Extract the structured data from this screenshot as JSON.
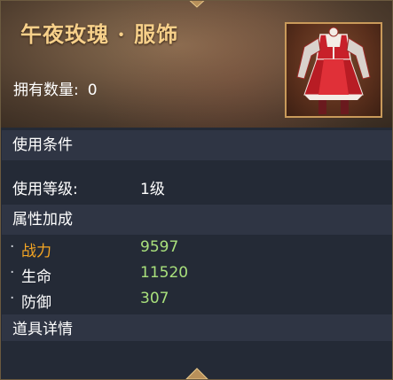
{
  "header": {
    "title": "午夜玫瑰 · 服饰",
    "owned_label": "拥有数量:",
    "owned_value": "0",
    "thumbnail_icon": "red-white-dress-costume-icon"
  },
  "usage": {
    "section_title": "使用条件",
    "level_label": "使用等级:",
    "level_value": "1级"
  },
  "attributes": {
    "section_title": "属性加成",
    "items": [
      {
        "name": "战力",
        "value": "9597",
        "highlight": true
      },
      {
        "name": "生命",
        "value": "11520",
        "highlight": false
      },
      {
        "name": "防御",
        "value": "307",
        "highlight": false
      }
    ]
  },
  "details": {
    "section_title": "道具详情"
  },
  "colors": {
    "title": "#f7d08a",
    "highlight": "#f5a623",
    "stat_value": "#a9e07c",
    "frame": "#c99a5a"
  }
}
